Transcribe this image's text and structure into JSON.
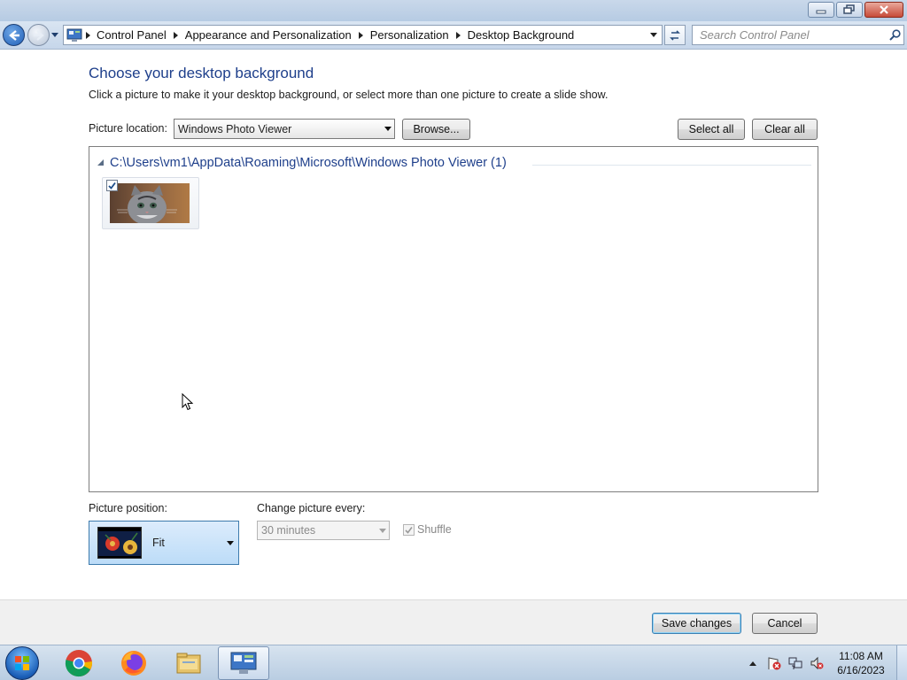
{
  "address_bar": {
    "breadcrumbs": [
      "Control Panel",
      "Appearance and Personalization",
      "Personalization",
      "Desktop Background"
    ],
    "search_placeholder": "Search Control Panel"
  },
  "page": {
    "title": "Choose your desktop background",
    "subtitle": "Click a picture to make it your desktop background, or select more than one picture to create a slide show."
  },
  "picture_location": {
    "label": "Picture location:",
    "value": "Windows Photo Viewer",
    "browse_label": "Browse...",
    "select_all_label": "Select all",
    "clear_all_label": "Clear all"
  },
  "gallery": {
    "group_title": "C:\\Users\\vm1\\AppData\\Roaming\\Microsoft\\Windows Photo Viewer (1)",
    "items": [
      {
        "icon": "cat-photo",
        "checked": true
      }
    ]
  },
  "picture_position": {
    "label": "Picture position:",
    "value": "Fit"
  },
  "change_picture": {
    "label": "Change picture every:",
    "value": "30 minutes",
    "shuffle_label": "Shuffle",
    "shuffle_checked": true,
    "enabled": false
  },
  "footer": {
    "save_label": "Save changes",
    "cancel_label": "Cancel"
  },
  "taskbar": {
    "apps": [
      "chrome-icon",
      "firefox-icon",
      "file-explorer-icon",
      "control-panel-icon"
    ],
    "clock_time": "11:08 AM",
    "clock_date": "6/16/2023"
  },
  "colors": {
    "title_blue": "#1e3f8b",
    "selection_blue": "#bcdcf8",
    "taskbar": "#b9cde2"
  }
}
